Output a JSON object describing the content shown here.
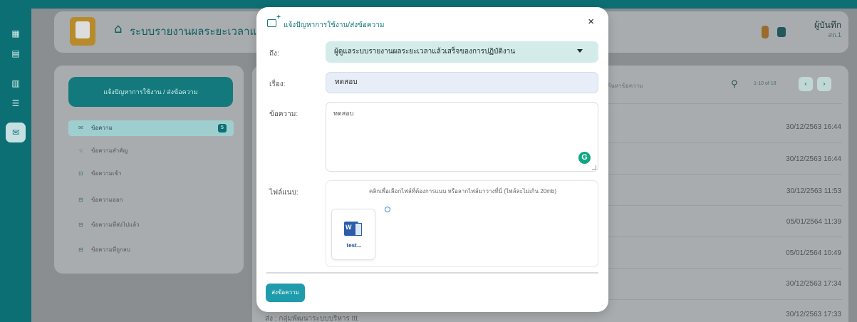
{
  "app": {
    "title": "ระบบรายงานผลระยะเวลาแล้วเสร็จ",
    "user_name": "ผู้บันทึก",
    "user_org": "สถ.1"
  },
  "sidebar": {
    "compose_label": "แจ้งปัญหาการใช้งาน / ส่งข้อความ",
    "items": [
      {
        "label": "ข้อความ",
        "badge": "5",
        "icon": "envelope-icon"
      },
      {
        "label": "ข้อความสำคัญ",
        "icon": "star-icon"
      },
      {
        "label": "ข้อความเข้า",
        "icon": "inbox-icon"
      },
      {
        "label": "ข้อความออก",
        "icon": "outbox-icon"
      },
      {
        "label": "ข้อความที่ส่งไปแล้ว",
        "icon": "sent-icon"
      },
      {
        "label": "ข้อความที่ถูกลบ",
        "icon": "trash-icon"
      }
    ]
  },
  "list": {
    "search_placeholder": "ค้นหาข้อความ",
    "pager": "1-10 of 18",
    "dates": [
      "30/12/2563 16:44",
      "30/12/2563 16:44",
      "30/12/2563 11:53",
      "05/01/2564 11:39",
      "05/01/2564 10:49",
      "30/12/2563 17:34",
      "30/12/2563 17:33"
    ],
    "last_row_text": "ส่ง : กลุ่มพัฒนาระบบบริหาร    ttt"
  },
  "modal": {
    "title": "แจ้งปัญหาการใช้งาน/ส่งข้อความ",
    "close": "×",
    "to_label": "ถึง:",
    "to_value": "ผู้ดูแลระบบรายงานผลระยะเวลาแล้วเสร็จของการปฏิบัติงาน",
    "subject_label": "เรื่อง:",
    "subject_value": "ทดสอบ",
    "message_label": "ข้อความ:",
    "message_value": "ทดสอบ",
    "attach_label": "ไฟล์แนบ:",
    "attach_hint": "คลิกเพื่อเลือกไฟล์ที่ต้องการแนบ หรือลากไฟล์มาวางที่นี่ (ไฟล์ละไม่เกิน 20mb)",
    "file_name": "test...",
    "send_label": "ส่งข้อความ"
  },
  "colors": {
    "brand": "#0c6f73",
    "accent": "#1f9cab",
    "select_bg": "#d3ece9",
    "grammarly": "#11a683"
  }
}
